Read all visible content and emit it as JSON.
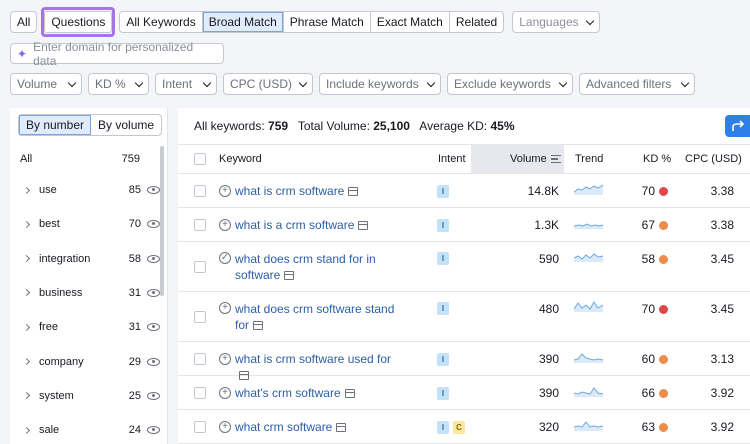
{
  "tabs": {
    "all": "All",
    "questions": "Questions",
    "group": [
      "All Keywords",
      "Broad Match",
      "Phrase Match",
      "Exact Match",
      "Related"
    ],
    "active_group_index": 1,
    "languages_placeholder": "Languages"
  },
  "domain_input": {
    "placeholder": "Enter domain for personalized data"
  },
  "filters": [
    "Volume",
    "KD %",
    "Intent",
    "CPC (USD)",
    "Include keywords",
    "Exclude keywords",
    "Advanced filters"
  ],
  "left_panel": {
    "toggle": [
      "By number",
      "By volume"
    ],
    "active_toggle_index": 0,
    "all_label": "All",
    "all_count": "759",
    "groups": [
      {
        "name": "use",
        "count": "85"
      },
      {
        "name": "best",
        "count": "70"
      },
      {
        "name": "integration",
        "count": "58"
      },
      {
        "name": "business",
        "count": "31"
      },
      {
        "name": "free",
        "count": "31"
      },
      {
        "name": "company",
        "count": "29"
      },
      {
        "name": "system",
        "count": "25"
      },
      {
        "name": "sale",
        "count": "24"
      }
    ]
  },
  "summary": {
    "all_keywords_label": "All keywords:",
    "all_keywords_value": "759",
    "total_volume_label": "Total Volume:",
    "total_volume_value": "25,100",
    "avg_kd_label": "Average KD:",
    "avg_kd_value": "45%"
  },
  "table": {
    "headers": {
      "keyword": "Keyword",
      "intent": "Intent",
      "volume": "Volume",
      "trend": "Trend",
      "kd": "KD %",
      "cpc": "CPC (USD)"
    },
    "kd_colors": {
      "red": "#e0474c",
      "orange": "#ee8c4a"
    },
    "rows": [
      {
        "keyword": "what is crm software",
        "intent": [
          "I"
        ],
        "volume": "14.8K",
        "kd": "70",
        "kd_level": "red",
        "cpc": "3.38",
        "icon": "plus"
      },
      {
        "keyword": "what is a crm software",
        "intent": [
          "I"
        ],
        "volume": "1.3K",
        "kd": "67",
        "kd_level": "orange",
        "cpc": "3.38",
        "icon": "plus"
      },
      {
        "keyword": "what does crm stand for in software",
        "intent": [
          "I"
        ],
        "volume": "590",
        "kd": "58",
        "kd_level": "orange",
        "cpc": "3.45",
        "icon": "check"
      },
      {
        "keyword": "what does crm software stand for",
        "intent": [
          "I"
        ],
        "volume": "480",
        "kd": "70",
        "kd_level": "red",
        "cpc": "3.45",
        "icon": "plus"
      },
      {
        "keyword": "what is crm software used for",
        "intent": [
          "I"
        ],
        "volume": "390",
        "kd": "60",
        "kd_level": "orange",
        "cpc": "3.13",
        "icon": "plus"
      },
      {
        "keyword": "what's crm software",
        "intent": [
          "I"
        ],
        "volume": "390",
        "kd": "66",
        "kd_level": "orange",
        "cpc": "3.92",
        "icon": "plus"
      },
      {
        "keyword": "what crm software",
        "intent": [
          "I",
          "C"
        ],
        "volume": "320",
        "kd": "63",
        "kd_level": "orange",
        "cpc": "3.92",
        "icon": "plus"
      }
    ]
  }
}
